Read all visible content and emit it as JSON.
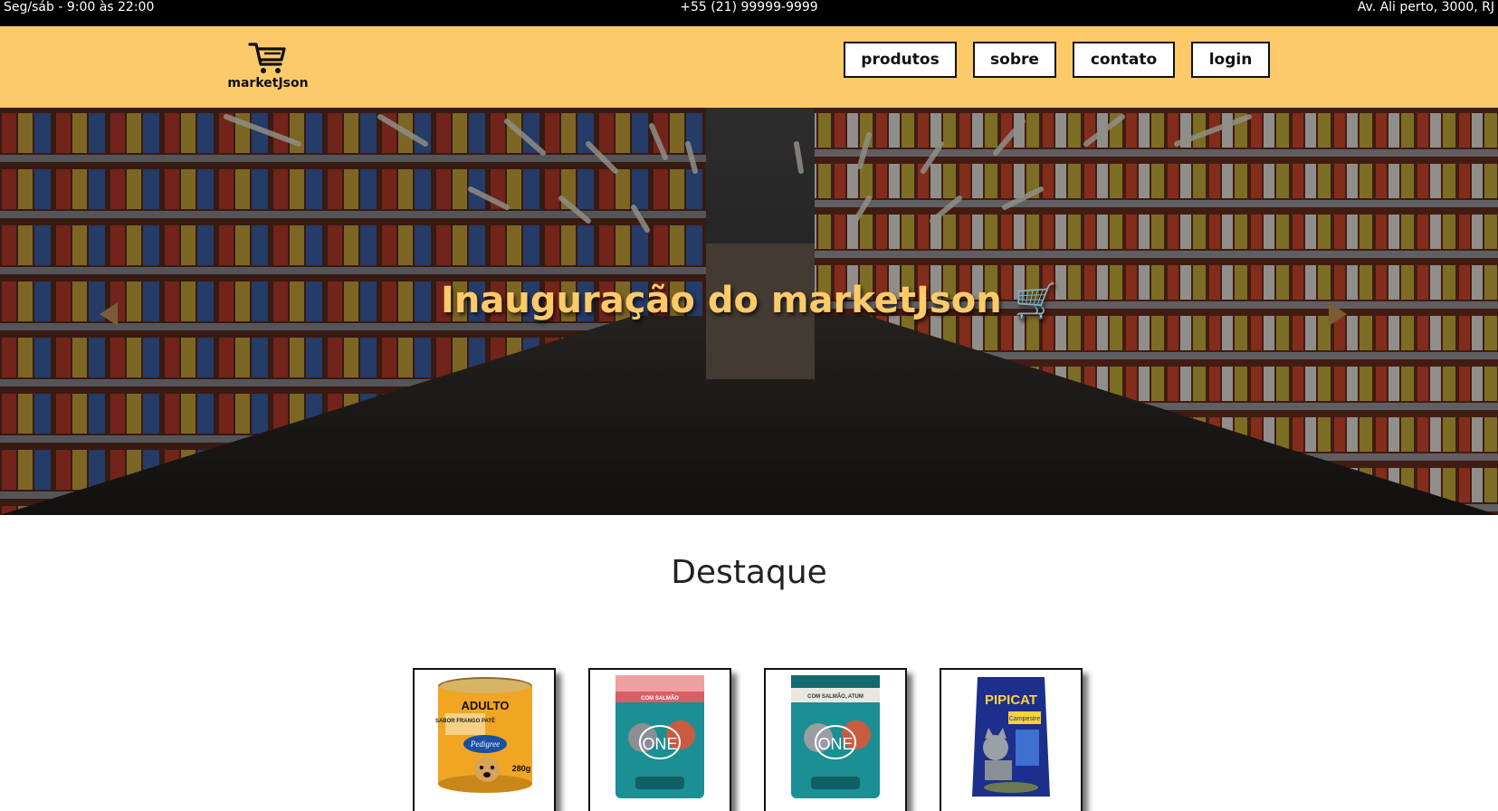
{
  "topbar": {
    "hours": "Seg/sáb - 9:00 às 22:00",
    "phone": "+55 (21) 99999-9999",
    "address": "Av. Ali perto, 3000, RJ"
  },
  "header": {
    "logo_text": "marketJson",
    "logo_icon": "shopping-cart-icon",
    "nav": [
      {
        "label": "produtos"
      },
      {
        "label": "sobre"
      },
      {
        "label": "contato"
      },
      {
        "label": "login"
      }
    ]
  },
  "hero": {
    "title": "Inauguração do marketJson",
    "title_icon": "shopping-cart-emoji",
    "prev_icon": "arrow-left-icon",
    "next_icon": "arrow-right-icon"
  },
  "featured": {
    "title": "Destaque",
    "products": [
      {
        "image": "pedigree-can-product-image",
        "label_top": "ADULTO",
        "label_sub": "SABOR FRANGO PATÊ",
        "brand": "Pedigree",
        "weight": "280g"
      },
      {
        "image": "purina-one-salmon-pouch-image",
        "flavor": "COM SALMÃO",
        "brand": "ONE"
      },
      {
        "image": "purina-one-multi-protein-pouch-image",
        "flavor": "COM SALMÃO, ATUM",
        "brand": "ONE"
      },
      {
        "image": "pipicat-litter-bag-image",
        "brand": "PIPICAT",
        "variant": "Campestre"
      }
    ]
  },
  "colors": {
    "accent": "#fdca6a",
    "topbar_bg": "#000000",
    "text_dark": "#111111"
  }
}
